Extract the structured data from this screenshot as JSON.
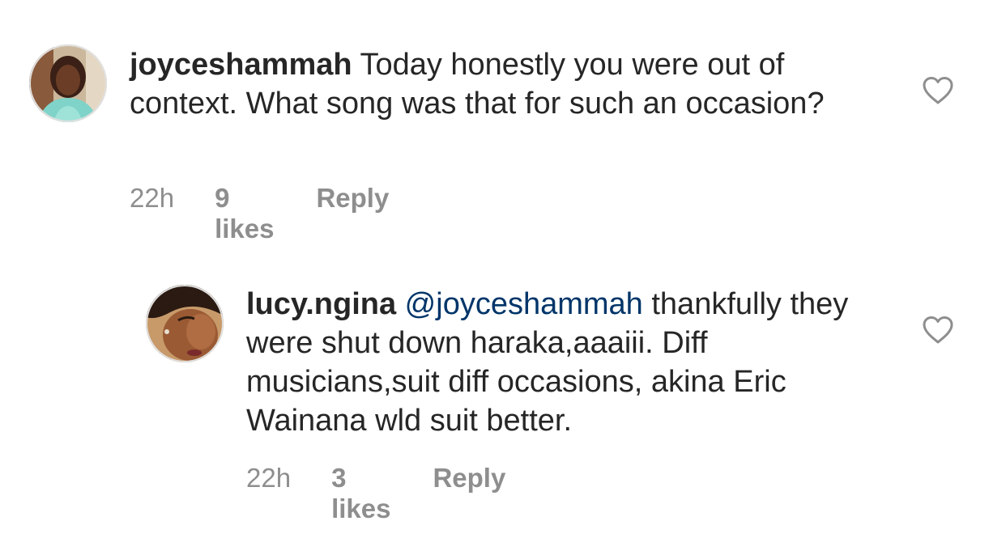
{
  "comments": [
    {
      "username": "joyceshammah",
      "text": " Today honestly you were out of context. What song was that for such an occasion?",
      "time": "22h",
      "likes": "9 likes",
      "reply": "Reply",
      "like_icon": "heart-outline-icon"
    },
    {
      "username": "lucy.ngina",
      "mention": "@joyceshammah",
      "text": " thankfully they were shut down haraka,aaaiii. Diff musicians,suit diff occasions, akina Eric Wainana wld suit better.",
      "time": "22h",
      "likes": "3 likes",
      "reply": "Reply",
      "like_icon": "heart-outline-icon"
    }
  ],
  "colors": {
    "text": "#262626",
    "secondary": "#8e8e8e",
    "mention": "#003569",
    "background": "#ffffff"
  }
}
